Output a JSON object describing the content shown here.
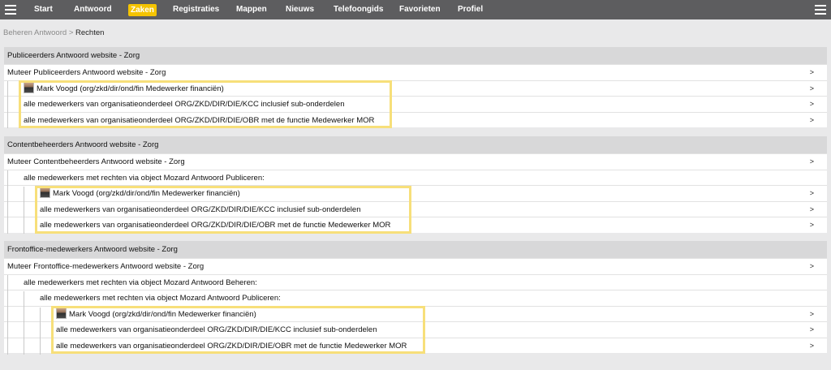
{
  "nav": {
    "items": [
      {
        "label": "Start"
      },
      {
        "label": "Antwoord"
      },
      {
        "label": "Zaken",
        "active": true
      },
      {
        "label": "Registraties"
      },
      {
        "label": "Mappen"
      },
      {
        "label": "Nieuws"
      },
      {
        "label": "Telefoongids"
      },
      {
        "label": "Favorieten"
      },
      {
        "label": "Profiel"
      }
    ],
    "menu_icon": "hamburger-icon"
  },
  "breadcrumb": {
    "parent": "Beheren Antwoord",
    "separator": ">",
    "current": "Rechten"
  },
  "arrow": ">",
  "sections": [
    {
      "title": "Publiceerders Antwoord website - Zorg",
      "mutate": "Muteer Publiceerders Antwoord website - Zorg",
      "person": "Mark Voogd (org/zkd/dir/ond/fin Medewerker financiën)",
      "line_kcc": "alle medewerkers van organisatieonderdeel ORG/ZKD/DIR/DIE/KCC inclusief sub-onderdelen",
      "line_obr": "alle medewerkers van organisatieonderdeel ORG/ZKD/DIR/DIE/OBR met de functie Medewerker MOR"
    },
    {
      "title": "Contentbeheerders Antwoord website - Zorg",
      "mutate": "Muteer Contentbeheerders Antwoord website - Zorg",
      "via_publiceren": "alle medewerkers met rechten via object Mozard Antwoord Publiceren:",
      "person": "Mark Voogd (org/zkd/dir/ond/fin Medewerker financiën)",
      "line_kcc": "alle medewerkers van organisatieonderdeel ORG/ZKD/DIR/DIE/KCC inclusief sub-onderdelen",
      "line_obr": "alle medewerkers van organisatieonderdeel ORG/ZKD/DIR/DIE/OBR met de functie Medewerker MOR"
    },
    {
      "title": "Frontoffice-medewerkers Antwoord website - Zorg",
      "mutate": "Muteer Frontoffice-medewerkers Antwoord website - Zorg",
      "via_beheren": "alle medewerkers met rechten via object Mozard Antwoord Beheren:",
      "via_publiceren": "alle medewerkers met rechten via object Mozard Antwoord Publiceren:",
      "person": "Mark Voogd (org/zkd/dir/ond/fin Medewerker financiën)",
      "line_kcc": "alle medewerkers van organisatieonderdeel ORG/ZKD/DIR/DIE/KCC inclusief sub-onderdelen",
      "line_obr": "alle medewerkers van organisatieonderdeel ORG/ZKD/DIR/DIE/OBR met de functie Medewerker MOR"
    }
  ],
  "colors": {
    "topbar": "#5d5d5f",
    "active_tab": "#f5c400",
    "highlight": "#f7df7a",
    "section_header": "#d8d8d9",
    "background": "#e9e9ea"
  }
}
